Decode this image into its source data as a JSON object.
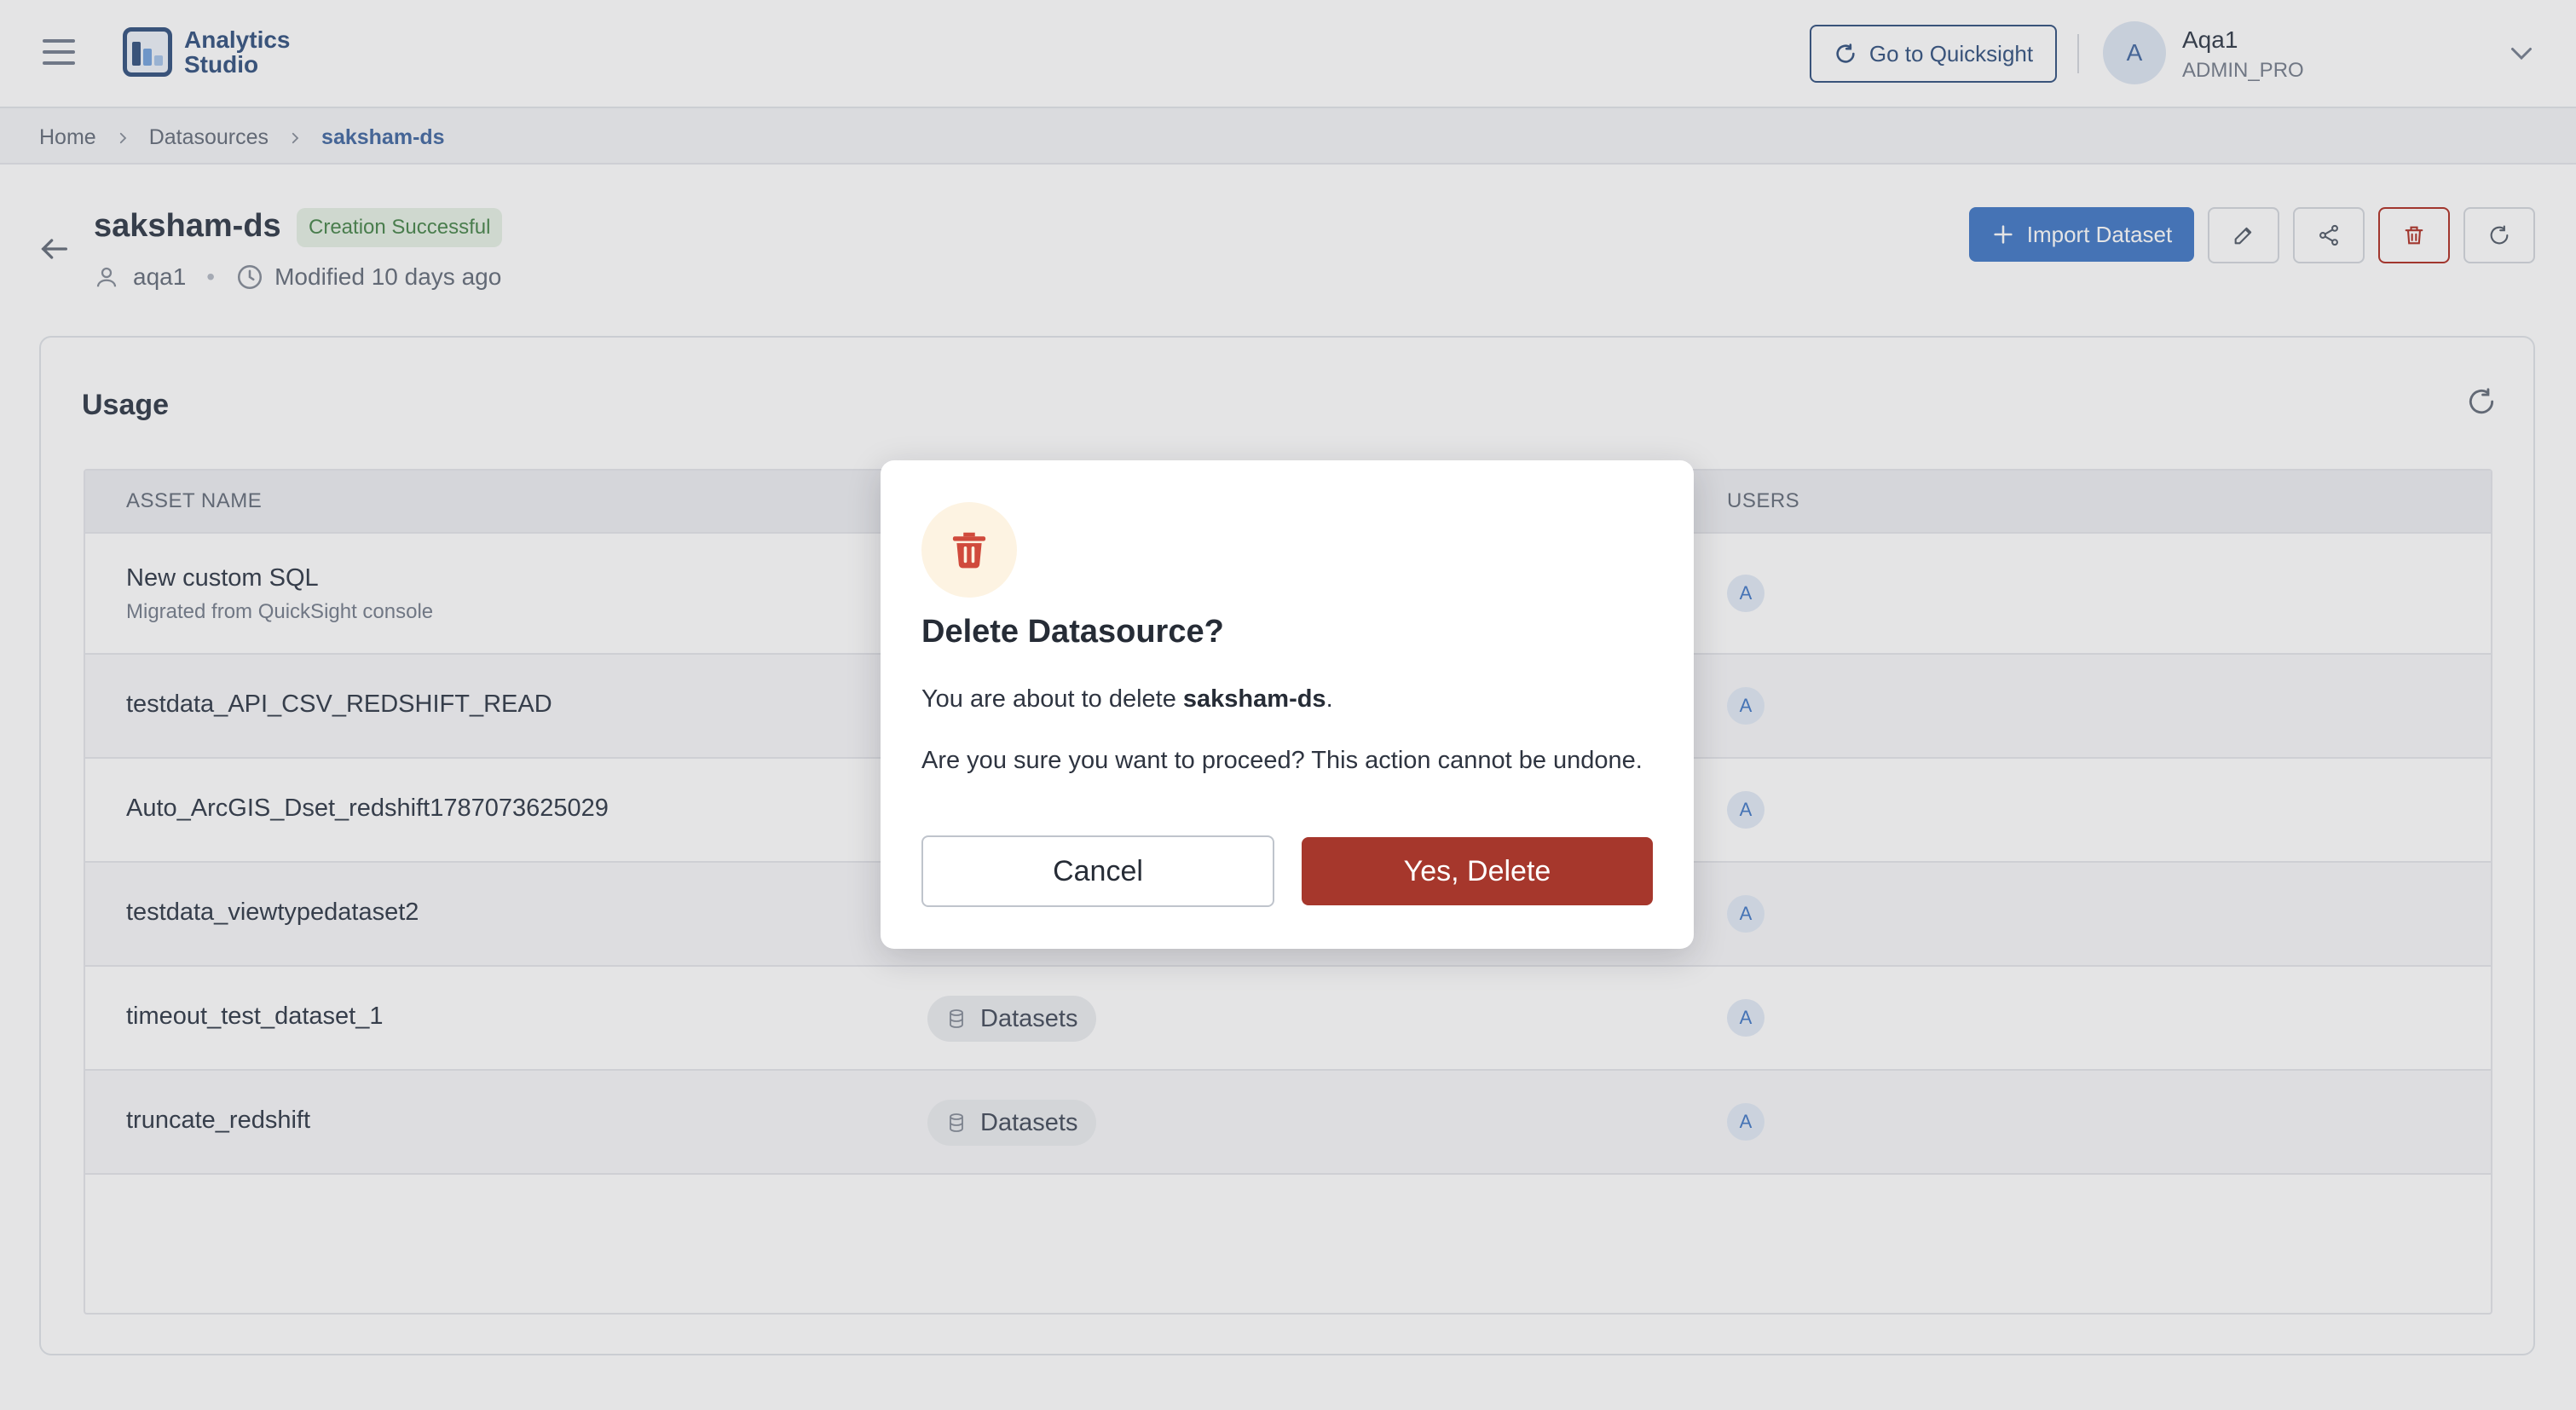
{
  "app": {
    "name_line1": "Analytics",
    "name_line2": "Studio",
    "quicksight_label": "Go to Quicksight"
  },
  "user": {
    "initial": "A",
    "name": "Aqa1",
    "role": "ADMIN_PRO"
  },
  "breadcrumb": [
    "Home",
    "Datasources",
    "saksham-ds"
  ],
  "datasource": {
    "name": "saksham-ds",
    "status": "Creation Successful",
    "owner": "aqa1",
    "meta_separator": "•",
    "modified": "Modified 10 days ago"
  },
  "actions": {
    "import_label": "Import Dataset"
  },
  "usage": {
    "title": "Usage",
    "columns": [
      "ASSET NAME",
      "USERS"
    ],
    "rows": [
      {
        "name": "New custom SQL",
        "subtitle": "Migrated from QuickSight console",
        "type": "",
        "user": "A"
      },
      {
        "name": "testdata_API_CSV_REDSHIFT_READ",
        "subtitle": "",
        "type": "",
        "user": "A"
      },
      {
        "name": "Auto_ArcGIS_Dset_redshift1787073625029",
        "subtitle": "",
        "type": "",
        "user": "A"
      },
      {
        "name": "testdata_viewtypedataset2",
        "subtitle": "",
        "type": "",
        "user": "A"
      },
      {
        "name": "timeout_test_dataset_1",
        "subtitle": "",
        "type": "Datasets",
        "user": "A"
      },
      {
        "name": "truncate_redshift",
        "subtitle": "",
        "type": "Datasets",
        "user": "A"
      }
    ]
  },
  "modal": {
    "title": "Delete Datasource?",
    "body_prefix": "You are about to delete ",
    "body_target": "saksham-ds",
    "body_suffix": ".",
    "confirm_text": "Are you sure you want to proceed? This action cannot be undone.",
    "cancel_label": "Cancel",
    "delete_label": "Yes, Delete"
  },
  "colors": {
    "brand": "#3d5a86",
    "primary": "#4a7fc9",
    "danger": "#a6372c",
    "success_bg": "#e8f2e6",
    "success_text": "#4f8a52"
  },
  "icons": [
    "menu-icon",
    "logo-icon",
    "refresh-icon",
    "chevron-down-icon",
    "chevron-right-icon",
    "arrow-left-icon",
    "user-icon",
    "clock-icon",
    "plus-icon",
    "pencil-icon",
    "share-icon",
    "trash-icon",
    "database-icon"
  ]
}
